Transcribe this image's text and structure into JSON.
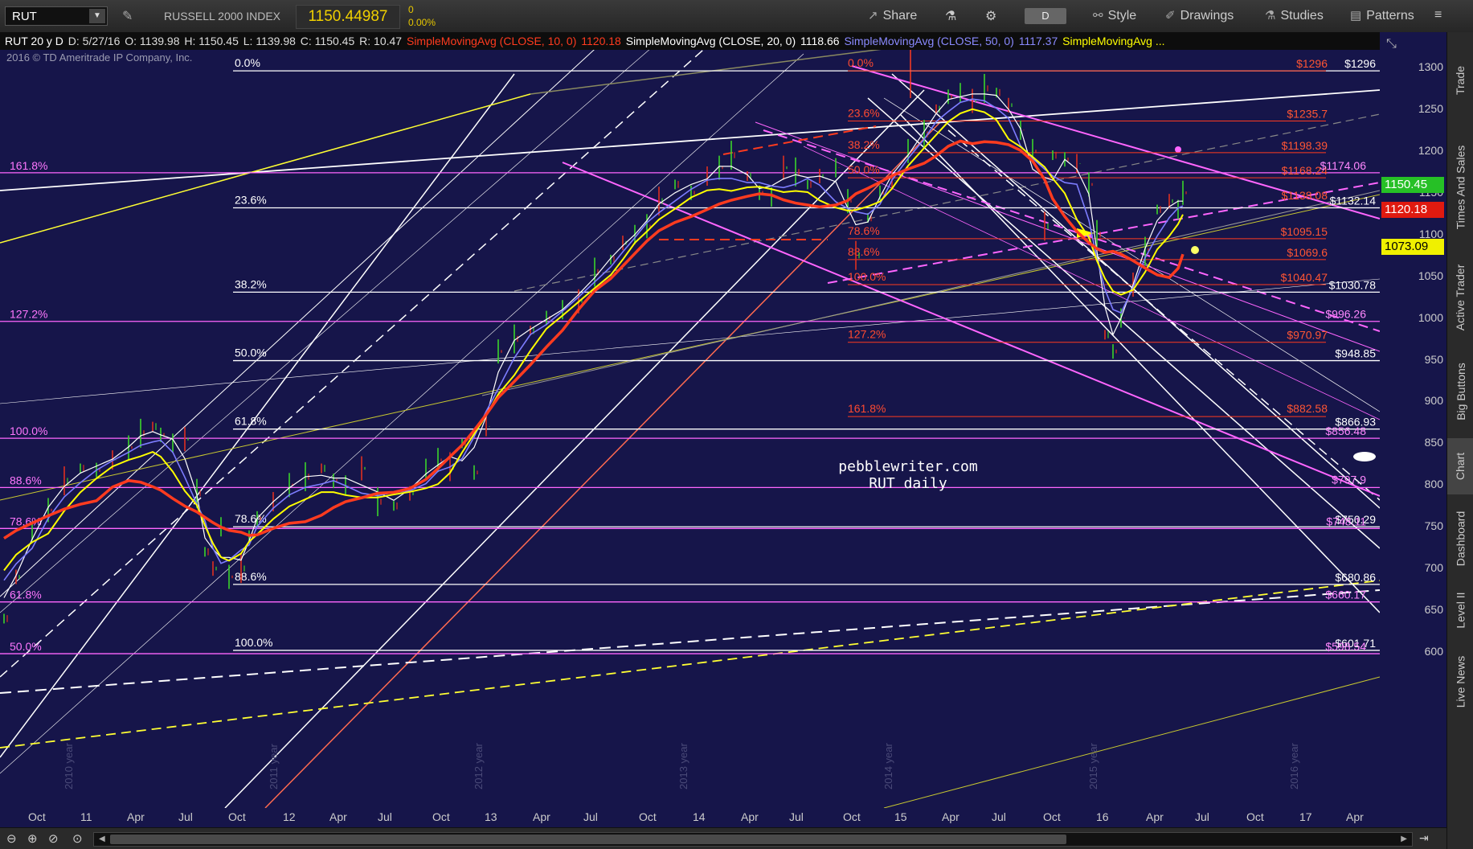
{
  "toolbar": {
    "symbol": "RUT",
    "description": "RUSSELL 2000 INDEX",
    "last": "1150.44987",
    "change": "0",
    "change_pct": "0.00%",
    "share": "Share",
    "timeframe": "D",
    "style": "Style",
    "drawings": "Drawings",
    "studies": "Studies",
    "patterns": "Patterns"
  },
  "infobar": {
    "ohlc": "RUT 20 y D",
    "date": "D: 5/27/16",
    "open": "O: 1139.98",
    "high": "H: 1150.45",
    "low": "L: 1139.98",
    "close": "C: 1150.45",
    "range": "R: 10.47",
    "sma10_label": "SimpleMovingAvg (CLOSE, 10, 0)",
    "sma10_val": "1120.18",
    "sma20_label": "SimpleMovingAvg (CLOSE, 20, 0)",
    "sma20_val": "1118.66",
    "sma50_label": "SimpleMovingAvg (CLOSE, 50, 0)",
    "sma50_val": "1117.37",
    "sma200_label": "SimpleMovingAvg ..."
  },
  "chart": {
    "copyright": "2016 © TD Ameritrade IP Company, Inc.",
    "watermark1": "pebblewriter.com",
    "watermark2": "RUT daily",
    "colors": {
      "bg": "#16154a",
      "sma10": "#ffffff",
      "sma20": "#7d7dff",
      "sma50": "#ffff00",
      "sma200": "#ff3b1f",
      "fib_white": "#ffffff",
      "fib_pink": "#ff66ff",
      "fib_red": "#ff3b1f"
    },
    "left_fibs": [
      {
        "label": "161.8%",
        "price": 1174
      },
      {
        "label": "127.2%",
        "price": 996
      },
      {
        "label": "100.0%",
        "price": 856
      },
      {
        "label": "88.6%",
        "price": 797
      },
      {
        "label": "78.6%",
        "price": 748
      },
      {
        "label": "61.8%",
        "price": 660
      },
      {
        "label": "50.0%",
        "price": 598
      }
    ],
    "mid_fibs": [
      {
        "label": "0.0%",
        "price": 1296
      },
      {
        "label": "23.6%",
        "price": 1132
      },
      {
        "label": "38.2%",
        "price": 1031
      },
      {
        "label": "50.0%",
        "price": 949
      },
      {
        "label": "61.8%",
        "price": 867
      }
    ],
    "lower_fibs": [
      {
        "label": "78.6%",
        "price": 750
      },
      {
        "label": "88.6%",
        "price": 681
      },
      {
        "label": "100.0%",
        "price": 602
      }
    ],
    "red_fibs": [
      {
        "label": "0.0%",
        "price": 1296
      },
      {
        "label": "23.6%",
        "price": 1236
      },
      {
        "label": "38.2%",
        "price": 1198
      },
      {
        "label": "50.0%",
        "price": 1168
      },
      {
        "label": "78.6%",
        "price": 1095
      },
      {
        "label": "88.6%",
        "price": 1070
      },
      {
        "label": "100.0%",
        "price": 1040
      },
      {
        "label": "127.2%",
        "price": 971
      },
      {
        "label": "161.8%",
        "price": 882
      }
    ],
    "price_levels": [
      {
        "label": "$1296",
        "price": 1296,
        "color": "#ff5533"
      },
      {
        "label": "$1296",
        "price": 1296,
        "color": "#ffffff"
      },
      {
        "label": "$1235.7",
        "price": 1236,
        "color": "#ff5533"
      },
      {
        "label": "$1198.39",
        "price": 1198,
        "color": "#ff5533"
      },
      {
        "label": "$1168.24",
        "price": 1168,
        "color": "#ff5533"
      },
      {
        "label": "$1174.06",
        "price": 1174,
        "color": "#ff88ff"
      },
      {
        "label": "$1138.08",
        "price": 1138,
        "color": "#ff5533"
      },
      {
        "label": "$1132.14",
        "price": 1132,
        "color": "#ffffff"
      },
      {
        "label": "$1095.15",
        "price": 1095,
        "color": "#ff5533"
      },
      {
        "label": "$1069.6",
        "price": 1070,
        "color": "#ff5533"
      },
      {
        "label": "$1040.47",
        "price": 1040,
        "color": "#ff5533"
      },
      {
        "label": "$1030.78",
        "price": 1031,
        "color": "#ffffff"
      },
      {
        "label": "$996.26",
        "price": 996,
        "color": "#ff88ff"
      },
      {
        "label": "$970.97",
        "price": 971,
        "color": "#ff5533"
      },
      {
        "label": "$948.85",
        "price": 949,
        "color": "#ffffff"
      },
      {
        "label": "$882.58",
        "price": 883,
        "color": "#ff5533"
      },
      {
        "label": "$866.93",
        "price": 867,
        "color": "#ffffff"
      },
      {
        "label": "$856.48",
        "price": 856,
        "color": "#ff88ff"
      },
      {
        "label": "$797.9",
        "price": 798,
        "color": "#ff88ff"
      },
      {
        "label": "$750.29",
        "price": 750,
        "color": "#ffffff"
      },
      {
        "label": "$748.11",
        "price": 748,
        "color": "#ff88ff"
      },
      {
        "label": "$680.86",
        "price": 681,
        "color": "#ffffff"
      },
      {
        "label": "$660.17",
        "price": 660,
        "color": "#ff88ff"
      },
      {
        "label": "$601.71",
        "price": 602,
        "color": "#ffffff"
      },
      {
        "label": "$598.54",
        "price": 598,
        "color": "#ff88ff"
      }
    ],
    "year_marks": [
      "2010 year",
      "2011 year",
      "2012 year",
      "2013 year",
      "2014 year",
      "2015 year",
      "2016 year"
    ]
  },
  "price_axis": {
    "ticks": [
      "1300",
      "1250",
      "1200",
      "1150",
      "1100",
      "1050",
      "1000",
      "950",
      "900",
      "850",
      "800",
      "750",
      "700",
      "650",
      "600"
    ],
    "last_badge": "1150.45",
    "sma10_badge": "1120.18",
    "sma50_badge": "1073.09"
  },
  "time_axis": {
    "labels": [
      "Oct",
      "11",
      "Apr",
      "Jul",
      "Oct",
      "12",
      "Apr",
      "Jul",
      "Oct",
      "13",
      "Apr",
      "Jul",
      "Oct",
      "14",
      "Apr",
      "Jul",
      "Oct",
      "15",
      "Apr",
      "Jul",
      "Oct",
      "16",
      "Apr",
      "Jul",
      "Oct",
      "17",
      "Apr"
    ]
  },
  "sidebar": {
    "tabs": [
      "Trade",
      "Times And Sales",
      "Active Trader",
      "Big Buttons",
      "Chart",
      "Dashboard",
      "Level II",
      "Live News"
    ]
  }
}
